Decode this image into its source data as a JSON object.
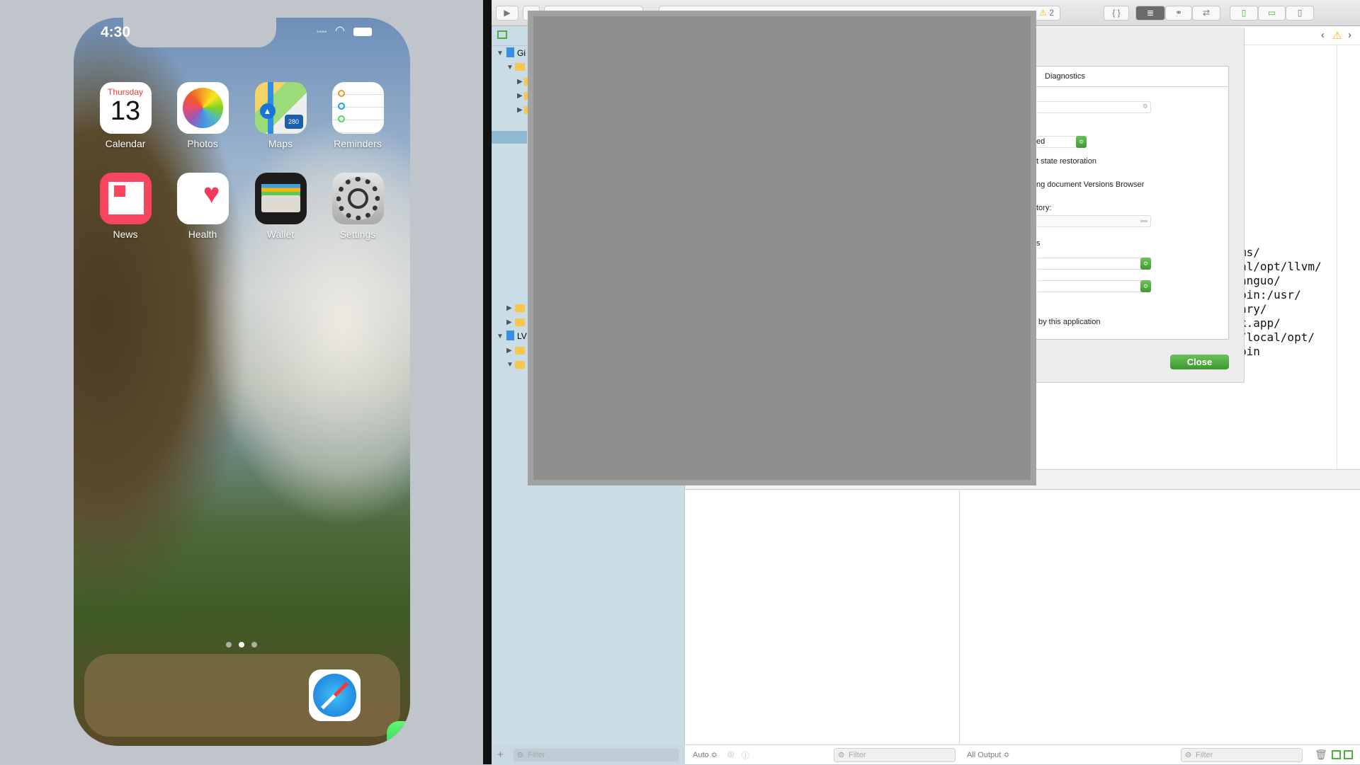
{
  "simulator": {
    "status_time": "4:30",
    "apps": [
      {
        "label": "Calendar",
        "icon": "calendar-icon",
        "day": "Thursday",
        "date": "13"
      },
      {
        "label": "Photos",
        "icon": "photos-icon"
      },
      {
        "label": "Maps",
        "icon": "maps-icon",
        "shield": "280"
      },
      {
        "label": "Reminders",
        "icon": "reminders-icon"
      },
      {
        "label": "News",
        "icon": "news-icon"
      },
      {
        "label": "Health",
        "icon": "health-icon"
      },
      {
        "label": "Wallet",
        "icon": "wallet-icon"
      },
      {
        "label": "Settings",
        "icon": "settings-icon"
      }
    ],
    "page_dots": {
      "count": 3,
      "active": 2
    },
    "dock": [
      {
        "icon": "safari-icon"
      },
      {
        "icon": "messages-icon"
      }
    ]
  },
  "xcode": {
    "toolbar": {
      "warning_count": "2"
    },
    "navigator": {
      "items": [
        {
          "label": "Gi"
        },
        {
          "label": "LV"
        }
      ]
    },
    "dialog": {
      "tab": "Diagnostics",
      "popup_value": "ed",
      "texts": [
        "t state restoration",
        "ng document Versions Browser",
        "tory:",
        "s",
        "by this application"
      ],
      "close_label": "Close"
    },
    "editor": {
      "code_lines": [
        "ms/",
        "al/opt/llvm/",
        "anguo/",
        "bin:/usr/",
        "ary/",
        "k.app/",
        "/local/opt/",
        "bin"
      ]
    },
    "bottom": {
      "filter_placeholder": "Filter",
      "auto_label": "Auto ≎",
      "output_label": "All Output ≎"
    },
    "colors": {
      "accent_green": "#4caf3a",
      "warning": "#f5b400",
      "navigator_bg": "#cadde6"
    }
  }
}
